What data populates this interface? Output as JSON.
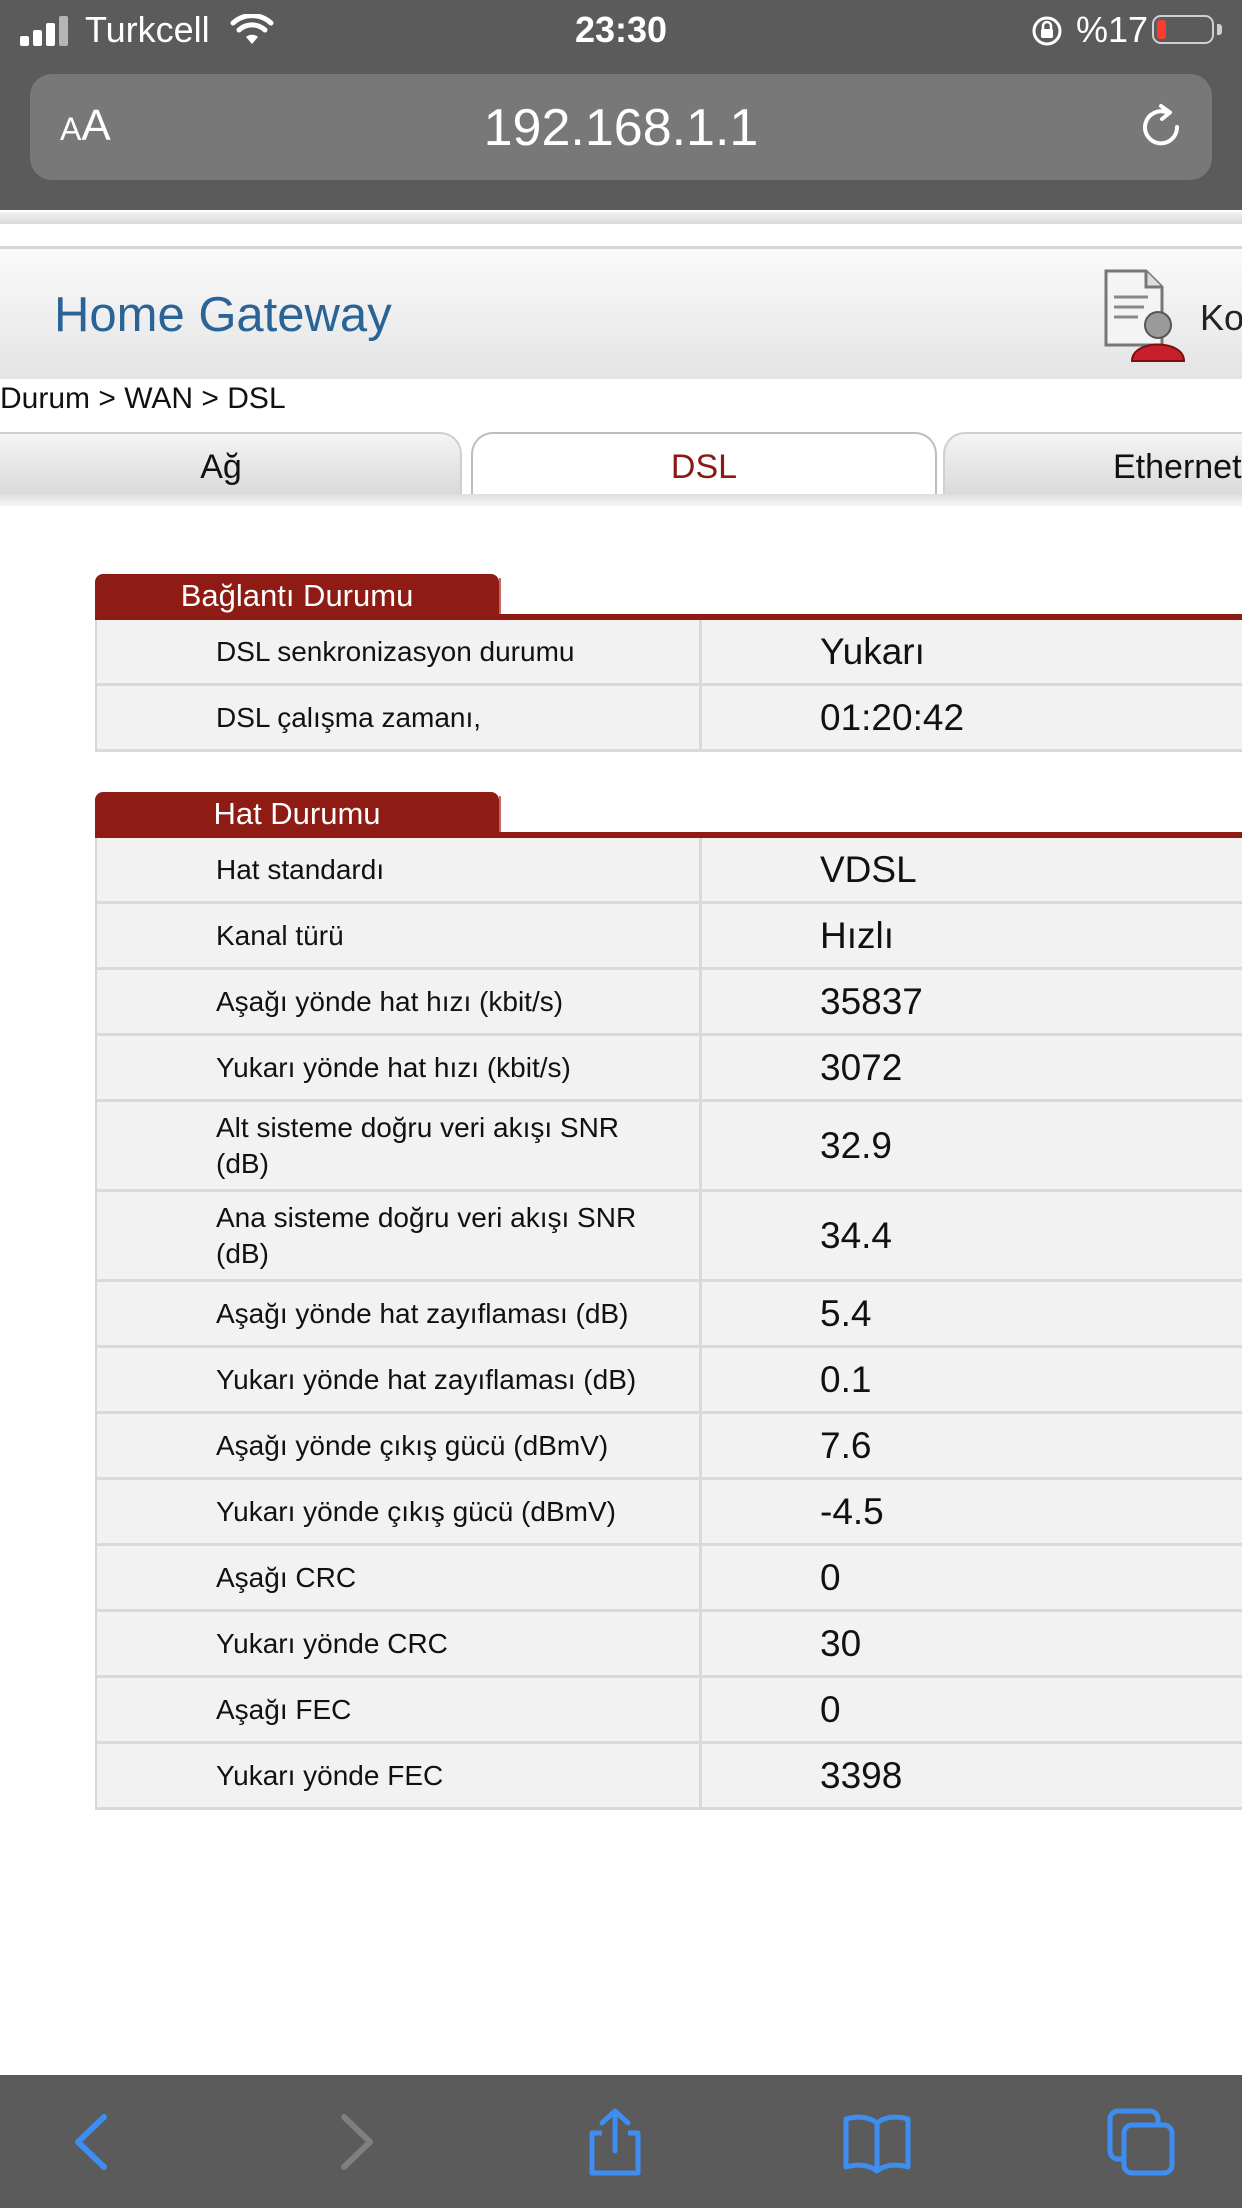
{
  "status_bar": {
    "carrier": "Turkcell",
    "time": "23:30",
    "battery_percent": "%17",
    "battery_level": 0.17
  },
  "browser": {
    "aa_label_small": "A",
    "aa_label_large": "A",
    "url": "192.168.1.1"
  },
  "header": {
    "title": "Home Gateway",
    "user_label": "Ko"
  },
  "breadcrumb": "Durum > WAN > DSL",
  "tabs": [
    {
      "label": "Ağ",
      "active": false
    },
    {
      "label": "DSL",
      "active": true
    },
    {
      "label": "Ethernet",
      "active": false
    }
  ],
  "sections": {
    "connection": {
      "title": "Bağlantı Durumu",
      "rows": [
        {
          "label": "DSL senkronizasyon durumu",
          "value": "Yukarı"
        },
        {
          "label": "DSL çalışma zamanı,",
          "value": "01:20:42"
        }
      ]
    },
    "line": {
      "title": "Hat Durumu",
      "rows": [
        {
          "label": "Hat standardı",
          "value": "VDSL"
        },
        {
          "label": "Kanal türü",
          "value": "Hızlı"
        },
        {
          "label": "Aşağı yönde hat hızı (kbit/s)",
          "value": "35837"
        },
        {
          "label": "Yukarı yönde hat hızı (kbit/s)",
          "value": "3072"
        },
        {
          "label": "Alt sisteme doğru veri akışı SNR (dB)",
          "value": "32.9"
        },
        {
          "label": "Ana sisteme doğru veri akışı SNR (dB)",
          "value": "34.4"
        },
        {
          "label": "Aşağı yönde hat zayıflaması (dB)",
          "value": "5.4"
        },
        {
          "label": "Yukarı yönde hat zayıflaması (dB)",
          "value": "0.1"
        },
        {
          "label": "Aşağı yönde çıkış gücü (dBmV)",
          "value": "7.6"
        },
        {
          "label": "Yukarı yönde çıkış gücü (dBmV)",
          "value": "-4.5"
        },
        {
          "label": "Aşağı CRC",
          "value": "0"
        },
        {
          "label": "Yukarı yönde CRC",
          "value": "30"
        },
        {
          "label": "Aşağı FEC",
          "value": "0"
        },
        {
          "label": "Yukarı yönde FEC",
          "value": "3398"
        }
      ]
    }
  },
  "colors": {
    "accent_red": "#8f1b15",
    "brand_blue": "#2a6496",
    "ios_blue": "#3d8ef0"
  },
  "toolbar_icons": [
    "back-icon",
    "forward-icon",
    "share-icon",
    "bookmarks-icon",
    "tabs-icon"
  ]
}
